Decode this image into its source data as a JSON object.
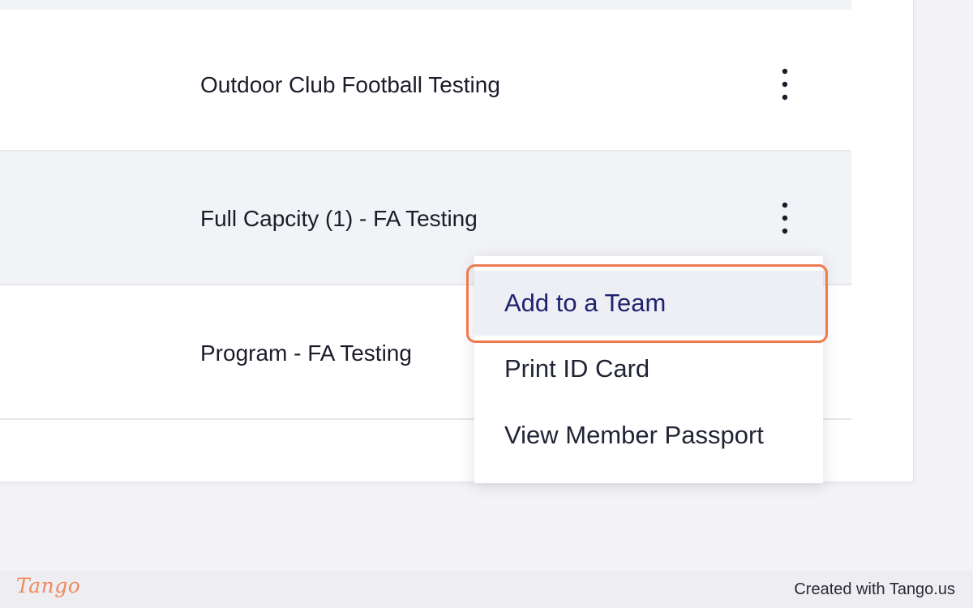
{
  "rows": [
    {
      "label": "Outdoor Club Football Testing"
    },
    {
      "label": "Full Capcity (1) - FA Testing"
    },
    {
      "label": "Program - FA Testing"
    }
  ],
  "menu": {
    "items": [
      {
        "label": "Add to a Team",
        "highlighted": true
      },
      {
        "label": "Print ID Card"
      },
      {
        "label": "View Member Passport"
      }
    ]
  },
  "footer": {
    "logo": "Tango",
    "credit": "Created with Tango.us"
  },
  "colors": {
    "highlight_border": "#f07a4e",
    "active_item_text": "#1e2270",
    "logo": "#f08a5d"
  },
  "icons": {
    "row_menu": "more-vertical-icon"
  }
}
